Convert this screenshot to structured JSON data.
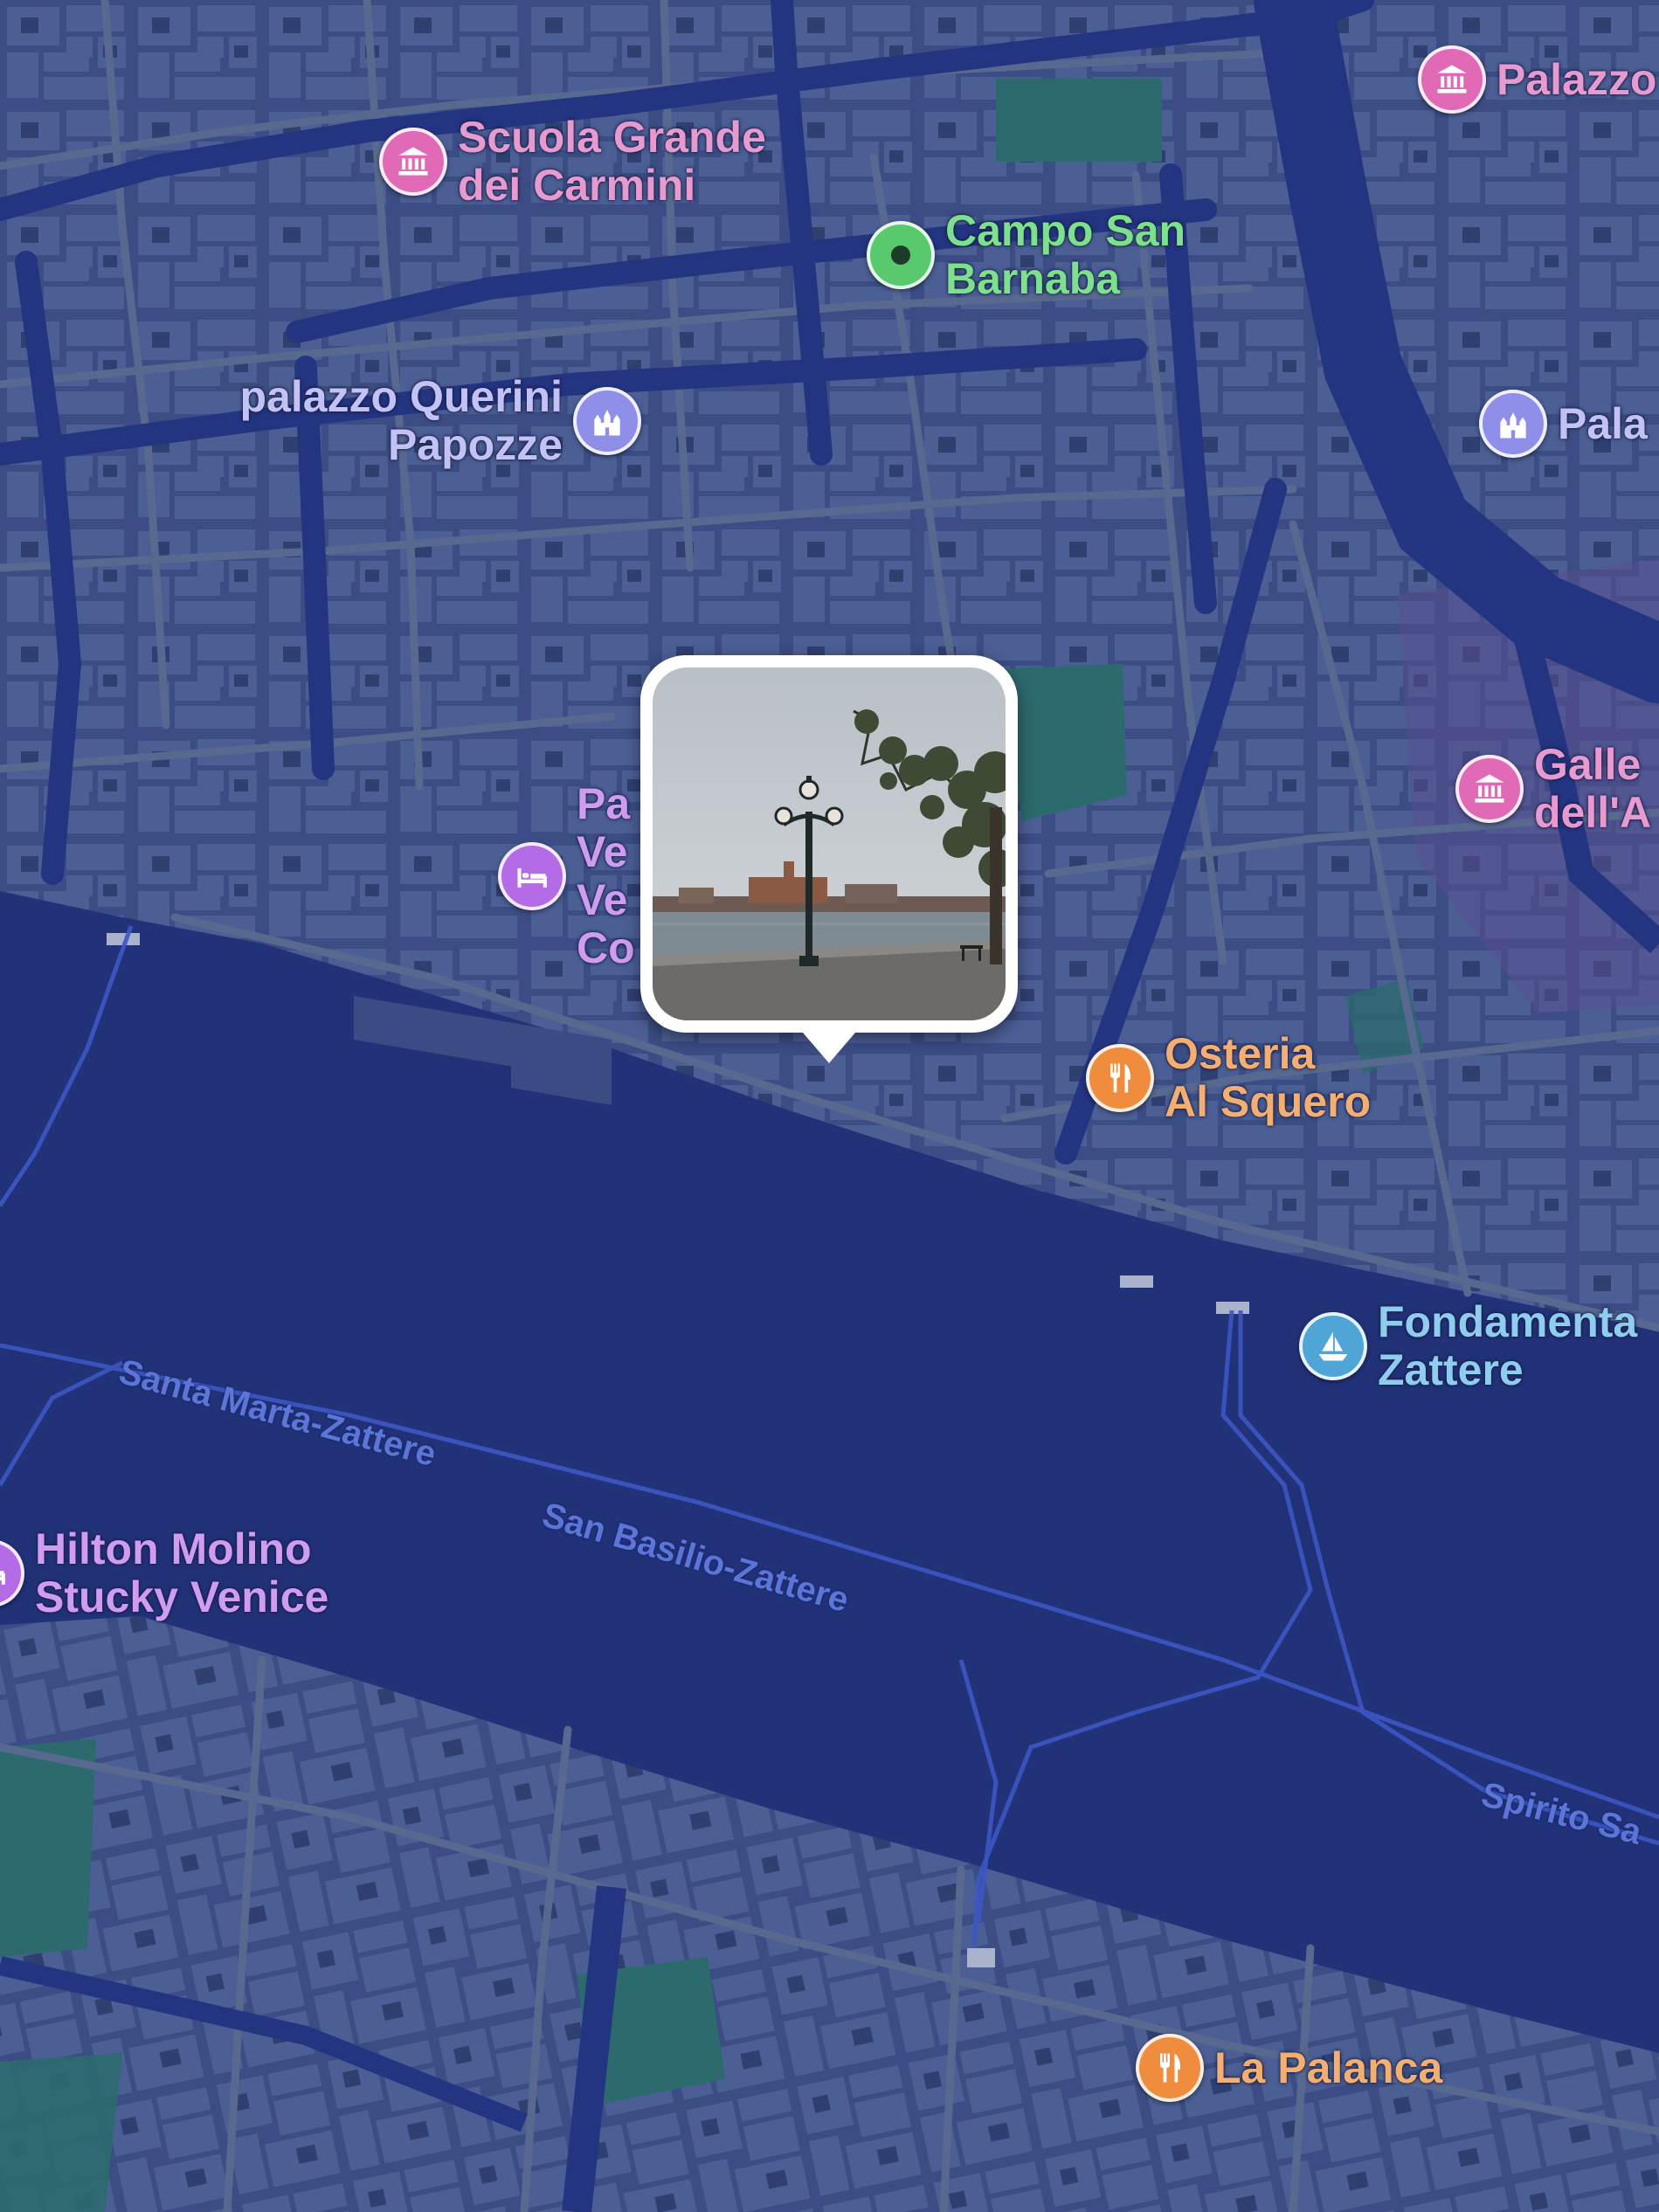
{
  "map": {
    "colors": {
      "water": "#223278",
      "land": "#3b4d84",
      "building": "#4b5f95",
      "street": "#56678e",
      "park": "#2c6a6e"
    },
    "pois": [
      {
        "id": "palazzo-top",
        "label": "Palazzo",
        "icon": "museum-icon",
        "color": "#e06ab6"
      },
      {
        "id": "scuola-grande",
        "label": "Scuola Grande\ndei Carmini",
        "icon": "museum-icon",
        "color": "#e06ab6"
      },
      {
        "id": "campo-san-barnaba",
        "label": "Campo San\nBarnaba",
        "icon": "park-dot-icon",
        "color": "#58c96c"
      },
      {
        "id": "palazzo-querini",
        "label": "palazzo Querini\nPapozze",
        "icon": "landmark-icon",
        "color": "#8f8ee8"
      },
      {
        "id": "pala-right",
        "label": "Pala",
        "icon": "landmark-icon",
        "color": "#8f8ee8"
      },
      {
        "id": "galleria",
        "label": "Galle\ndell'A",
        "icon": "museum-icon",
        "color": "#e06ab6"
      },
      {
        "id": "hotel-pa",
        "label": "Pa\nVe\nVe\nCo",
        "icon": "bed-icon",
        "color": "#b36be6"
      },
      {
        "id": "osteria",
        "label": "Osteria\nAl Squero",
        "icon": "fork-knife-icon",
        "color": "#ef8c3e"
      },
      {
        "id": "fondamenta",
        "label": "Fondamenta\nZattere",
        "icon": "sailboat-icon",
        "color": "#4fa5d6"
      },
      {
        "id": "hilton",
        "label": "Hilton Molino\nStucky Venice",
        "icon": "bed-icon",
        "color": "#b36be6"
      },
      {
        "id": "la-palanca",
        "label": "La Palanca",
        "icon": "fork-knife-icon",
        "color": "#ef8c3e"
      }
    ],
    "water_labels": [
      {
        "id": "santa-marta",
        "text": "Santa Marta-Zattere"
      },
      {
        "id": "san-basilio",
        "text": "San Basilio-Zattere"
      },
      {
        "id": "spirito-santo",
        "text": "Spirito Sa"
      }
    ],
    "photo_callout": {
      "icon": "photo-thumbnail"
    }
  }
}
